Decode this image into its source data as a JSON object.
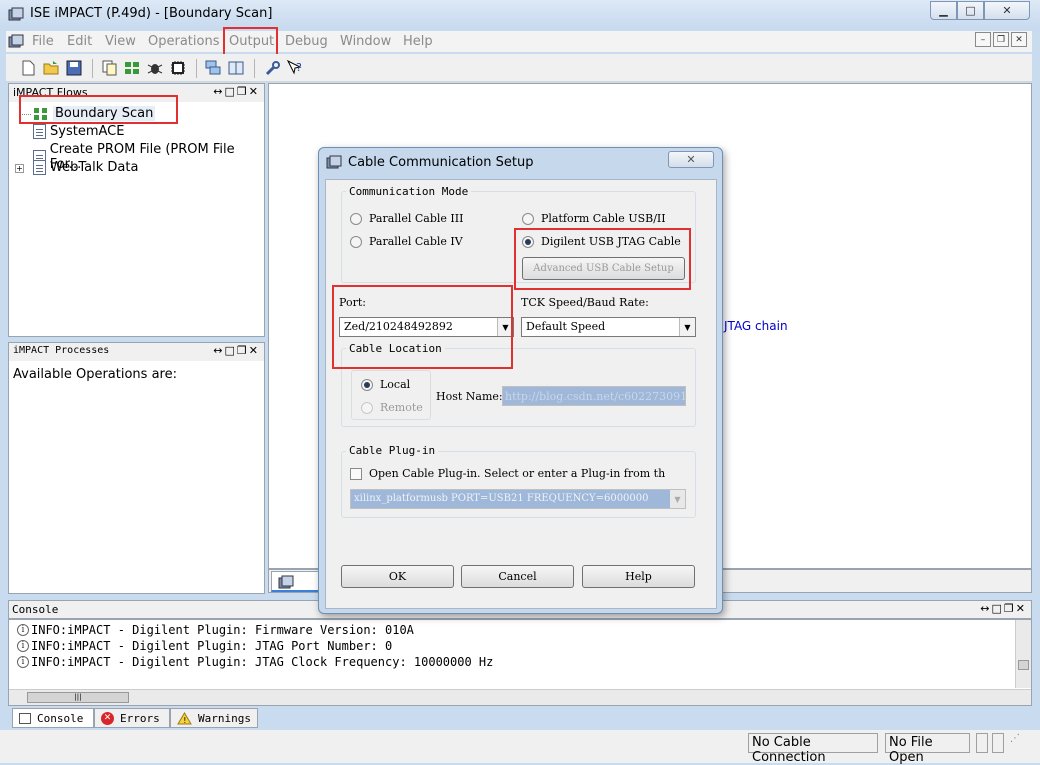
{
  "window": {
    "title": "ISE iMPACT (P.49d) - [Boundary Scan]",
    "controls": {
      "minimize": "▁",
      "maximize": "□",
      "close": "✕"
    }
  },
  "menu": [
    "File",
    "Edit",
    "View",
    "Operations",
    "Output",
    "Debug",
    "Window",
    "Help"
  ],
  "toolbar_icons": [
    "new-file-icon",
    "open-folder-icon",
    "save-icon",
    "copy-icon",
    "boundary-scan-icon",
    "debug-icon",
    "chip-icon",
    "cascade-icon",
    "tile-icon",
    "wrench-icon",
    "context-help-icon"
  ],
  "flows_panel": {
    "title": "iMPACT Flows",
    "items": [
      "Boundary Scan",
      "SystemACE",
      "Create PROM File (PROM File For...",
      "WebTalk Data"
    ]
  },
  "processes_panel": {
    "title": "iMPACT Processes",
    "content": "Available Operations are:"
  },
  "workspace": {
    "jtag_text": "JTAG chain"
  },
  "dialog": {
    "title": "Cable Communication Setup",
    "comm_mode_label": "Communication Mode",
    "options": {
      "parallel3": "Parallel Cable III",
      "parallel4": "Parallel Cable IV",
      "platform_usb": "Platform Cable USB/II",
      "digilent_jtag": "Digilent USB JTAG Cable"
    },
    "selected_mode": "Digilent USB JTAG Cable",
    "advanced_button": "Advanced USB Cable Setup",
    "port_label": "Port:",
    "port_value": "Zed/210248492892",
    "tck_label": "TCK Speed/Baud Rate:",
    "tck_value": "Default Speed",
    "cable_location_label": "Cable Location",
    "local": "Local",
    "remote": "Remote",
    "host_label": "Host Name:",
    "host_value": "http://blog.csdn.net/c602273091",
    "plugin_label": "Cable Plug-in",
    "plugin_checkbox": "Open Cable Plug-in. Select or enter a Plug-in from th",
    "plugin_value": "xilinx_platformusb PORT=USB21 FREQUENCY=6000000",
    "buttons": {
      "ok": "OK",
      "cancel": "Cancel",
      "help": "Help"
    }
  },
  "console": {
    "title": "Console",
    "lines": [
      "INFO:iMPACT - Digilent Plugin: Firmware Version: 010A",
      "INFO:iMPACT - Digilent Plugin: JTAG Port Number: 0",
      "INFO:iMPACT - Digilent Plugin: JTAG Clock Frequency: 10000000 Hz"
    ],
    "tabs": [
      "Console",
      "Errors",
      "Warnings"
    ]
  },
  "status": [
    "No Cable Connection",
    "No File Open"
  ],
  "colors": {
    "highlight_box": "#e03030",
    "selection": "#9fb8d9",
    "link_text": "#0000cc"
  }
}
